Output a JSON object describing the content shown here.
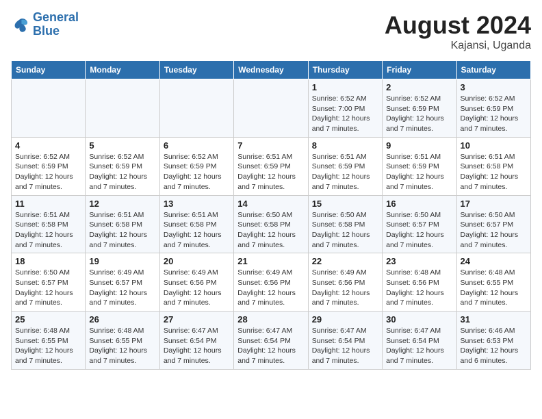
{
  "header": {
    "logo_line1": "General",
    "logo_line2": "Blue",
    "month_year": "August 2024",
    "location": "Kajansi, Uganda"
  },
  "weekdays": [
    "Sunday",
    "Monday",
    "Tuesday",
    "Wednesday",
    "Thursday",
    "Friday",
    "Saturday"
  ],
  "weeks": [
    [
      {
        "day": "",
        "info": ""
      },
      {
        "day": "",
        "info": ""
      },
      {
        "day": "",
        "info": ""
      },
      {
        "day": "",
        "info": ""
      },
      {
        "day": "1",
        "info": "Sunrise: 6:52 AM\nSunset: 7:00 PM\nDaylight: 12 hours and 7 minutes."
      },
      {
        "day": "2",
        "info": "Sunrise: 6:52 AM\nSunset: 6:59 PM\nDaylight: 12 hours and 7 minutes."
      },
      {
        "day": "3",
        "info": "Sunrise: 6:52 AM\nSunset: 6:59 PM\nDaylight: 12 hours and 7 minutes."
      }
    ],
    [
      {
        "day": "4",
        "info": "Sunrise: 6:52 AM\nSunset: 6:59 PM\nDaylight: 12 hours and 7 minutes."
      },
      {
        "day": "5",
        "info": "Sunrise: 6:52 AM\nSunset: 6:59 PM\nDaylight: 12 hours and 7 minutes."
      },
      {
        "day": "6",
        "info": "Sunrise: 6:52 AM\nSunset: 6:59 PM\nDaylight: 12 hours and 7 minutes."
      },
      {
        "day": "7",
        "info": "Sunrise: 6:51 AM\nSunset: 6:59 PM\nDaylight: 12 hours and 7 minutes."
      },
      {
        "day": "8",
        "info": "Sunrise: 6:51 AM\nSunset: 6:59 PM\nDaylight: 12 hours and 7 minutes."
      },
      {
        "day": "9",
        "info": "Sunrise: 6:51 AM\nSunset: 6:59 PM\nDaylight: 12 hours and 7 minutes."
      },
      {
        "day": "10",
        "info": "Sunrise: 6:51 AM\nSunset: 6:58 PM\nDaylight: 12 hours and 7 minutes."
      }
    ],
    [
      {
        "day": "11",
        "info": "Sunrise: 6:51 AM\nSunset: 6:58 PM\nDaylight: 12 hours and 7 minutes."
      },
      {
        "day": "12",
        "info": "Sunrise: 6:51 AM\nSunset: 6:58 PM\nDaylight: 12 hours and 7 minutes."
      },
      {
        "day": "13",
        "info": "Sunrise: 6:51 AM\nSunset: 6:58 PM\nDaylight: 12 hours and 7 minutes."
      },
      {
        "day": "14",
        "info": "Sunrise: 6:50 AM\nSunset: 6:58 PM\nDaylight: 12 hours and 7 minutes."
      },
      {
        "day": "15",
        "info": "Sunrise: 6:50 AM\nSunset: 6:58 PM\nDaylight: 12 hours and 7 minutes."
      },
      {
        "day": "16",
        "info": "Sunrise: 6:50 AM\nSunset: 6:57 PM\nDaylight: 12 hours and 7 minutes."
      },
      {
        "day": "17",
        "info": "Sunrise: 6:50 AM\nSunset: 6:57 PM\nDaylight: 12 hours and 7 minutes."
      }
    ],
    [
      {
        "day": "18",
        "info": "Sunrise: 6:50 AM\nSunset: 6:57 PM\nDaylight: 12 hours and 7 minutes."
      },
      {
        "day": "19",
        "info": "Sunrise: 6:49 AM\nSunset: 6:57 PM\nDaylight: 12 hours and 7 minutes."
      },
      {
        "day": "20",
        "info": "Sunrise: 6:49 AM\nSunset: 6:56 PM\nDaylight: 12 hours and 7 minutes."
      },
      {
        "day": "21",
        "info": "Sunrise: 6:49 AM\nSunset: 6:56 PM\nDaylight: 12 hours and 7 minutes."
      },
      {
        "day": "22",
        "info": "Sunrise: 6:49 AM\nSunset: 6:56 PM\nDaylight: 12 hours and 7 minutes."
      },
      {
        "day": "23",
        "info": "Sunrise: 6:48 AM\nSunset: 6:56 PM\nDaylight: 12 hours and 7 minutes."
      },
      {
        "day": "24",
        "info": "Sunrise: 6:48 AM\nSunset: 6:55 PM\nDaylight: 12 hours and 7 minutes."
      }
    ],
    [
      {
        "day": "25",
        "info": "Sunrise: 6:48 AM\nSunset: 6:55 PM\nDaylight: 12 hours and 7 minutes."
      },
      {
        "day": "26",
        "info": "Sunrise: 6:48 AM\nSunset: 6:55 PM\nDaylight: 12 hours and 7 minutes."
      },
      {
        "day": "27",
        "info": "Sunrise: 6:47 AM\nSunset: 6:54 PM\nDaylight: 12 hours and 7 minutes."
      },
      {
        "day": "28",
        "info": "Sunrise: 6:47 AM\nSunset: 6:54 PM\nDaylight: 12 hours and 7 minutes."
      },
      {
        "day": "29",
        "info": "Sunrise: 6:47 AM\nSunset: 6:54 PM\nDaylight: 12 hours and 7 minutes."
      },
      {
        "day": "30",
        "info": "Sunrise: 6:47 AM\nSunset: 6:54 PM\nDaylight: 12 hours and 7 minutes."
      },
      {
        "day": "31",
        "info": "Sunrise: 6:46 AM\nSunset: 6:53 PM\nDaylight: 12 hours and 6 minutes."
      }
    ]
  ]
}
